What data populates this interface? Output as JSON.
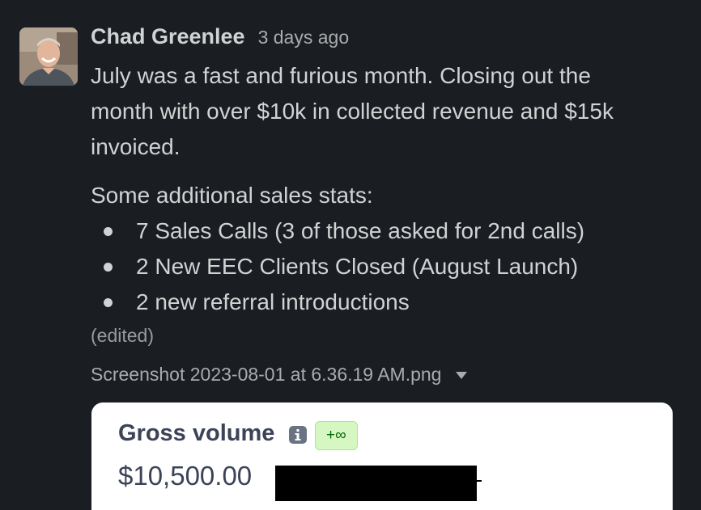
{
  "message": {
    "sender": "Chad Greenlee",
    "timestamp": "3 days ago",
    "paragraph1": "July was a fast and furious month.  Closing out the\nmonth with over $10k in collected revenue and $15k\ninvoiced.",
    "paragraph2_intro": "Some additional sales stats:",
    "stats": [
      "7 Sales Calls (3 of those asked for 2nd calls)",
      "2 New EEC Clients Closed (August Launch)",
      "2 new referral introductions"
    ],
    "edited": "(edited)"
  },
  "attachment": {
    "filename": "Screenshot 2023-08-01 at 6.36.19 AM.png",
    "preview": {
      "title": "Gross volume",
      "badge": "+∞",
      "amount": "$10,500.00"
    }
  },
  "colors": {
    "background": "#1a1d21",
    "text": "#d1d2d3",
    "muted": "#ababad",
    "badge_bg": "#d7f7c2",
    "badge_text": "#05690d"
  },
  "icons": {
    "avatar": "user-photo-avatar",
    "info": "info-icon",
    "caret": "caret-down-icon"
  }
}
